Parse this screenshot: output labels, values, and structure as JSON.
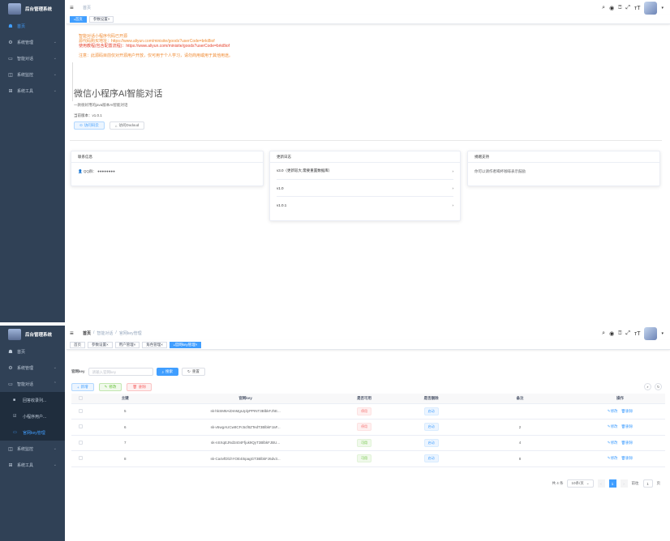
{
  "app": {
    "title": "后台管理系统"
  },
  "screen1": {
    "menu": [
      {
        "icon": "home-icon",
        "glyph": "☗",
        "label": "首页",
        "active": true
      },
      {
        "icon": "gear-icon",
        "glyph": "⚙",
        "label": "系统管理"
      },
      {
        "icon": "chat-icon",
        "glyph": "▭",
        "label": "智能对话"
      },
      {
        "icon": "monitor-icon",
        "glyph": "◫",
        "label": "系统监控"
      },
      {
        "icon": "tools-icon",
        "glyph": "⊞",
        "label": "系统工具"
      }
    ],
    "breadcrumb": [
      "首页"
    ],
    "tags": [
      {
        "label": "首页",
        "active": true
      },
      {
        "label": "参数设置"
      }
    ],
    "notice": {
      "line1": "智能对话小程序代码已开源",
      "line2": "源代码购买地址：https://www.aliyun.com/minisite/goods?userCode=brki8iof",
      "line3": "使用教程(包含配置流程)：https://www.aliyun.com/minisite/goods?userCode=brki8iof",
      "line4": "注意：此源码目前仅对开源用户开放，仅可用于个人学习，请勿商用或用于其他用途。"
    },
    "intro": {
      "title": "微信小程序AI智能对话",
      "desc": "一款很好用的java版本AI智能对话",
      "version": "当前版本：v1.0.1",
      "btn_home": "访问码云",
      "btn_dodoud": "访问Dodoud"
    },
    "cards": {
      "contact": {
        "title": "联系信息",
        "qq": "QQ群：   ●●●●●●●●"
      },
      "changelog": {
        "title": "更新日志",
        "items": [
          "v3.0（更新较大,需要重置数据库）",
          "v1.0",
          "v1.0.1"
        ]
      },
      "donate": {
        "title": "捐赠支持",
        "text": "你可以请作者喝杯咖啡表示鼓励"
      }
    }
  },
  "screen2": {
    "menu": [
      {
        "icon": "home-icon",
        "glyph": "☗",
        "label": "首页"
      },
      {
        "icon": "gear-icon",
        "glyph": "⚙",
        "label": "系统管理"
      },
      {
        "icon": "chat-icon",
        "glyph": "▭",
        "label": "智能对话",
        "open": true
      }
    ],
    "submenu": [
      {
        "icon": "list-icon",
        "glyph": "■",
        "label": "回答收录列..."
      },
      {
        "icon": "edit-icon",
        "glyph": "☑",
        "label": "小程序用户..."
      },
      {
        "icon": "key-icon",
        "glyph": "▭",
        "label": "官网key管理",
        "active": true
      }
    ],
    "menu_after": [
      {
        "icon": "monitor-icon",
        "glyph": "◫",
        "label": "系统监控"
      },
      {
        "icon": "tools-icon",
        "glyph": "⊞",
        "label": "系统工具"
      }
    ],
    "breadcrumb": [
      "首页",
      "智能对话",
      "官网key管理"
    ],
    "tags": [
      {
        "label": "首页"
      },
      {
        "label": "参数设置"
      },
      {
        "label": "用户管理"
      },
      {
        "label": "角色管理"
      },
      {
        "label": "官网key管理",
        "active": true
      }
    ],
    "search": {
      "label": "官网key",
      "placeholder": "请输入官网key",
      "search_btn": "搜索",
      "reset_btn": "重置"
    },
    "toolbar": {
      "add": "新增",
      "edit": "修改",
      "delete": "删除"
    },
    "table": {
      "headers": [
        "",
        "主键",
        "官网key",
        "是否可用",
        "是否删除",
        "备注",
        "操作"
      ],
      "rows": [
        {
          "id": "5",
          "key": "sk-hkSM8AiDmMgsJplyPPINT3BlbkFJhE...",
          "usable": "停用",
          "usable_color": "red",
          "deleted": "启动",
          "remark": ""
        },
        {
          "id": "6",
          "key": "sk-v5wgAUCw8CFc5cf8ZTedT3BlbkFJaF...",
          "usable": "停用",
          "usable_color": "red",
          "deleted": "启动",
          "remark": "2"
        },
        {
          "id": "7",
          "key": "sk-nSXqEJNd3404Ffjuk9QyT3BlbkFJBU...",
          "usable": "可用",
          "usable_color": "green",
          "deleted": "启动",
          "remark": "4"
        },
        {
          "id": "8",
          "key": "sk-Ca4vfDl1hYOE4i5pagGT3BlbkFJ6dv3...",
          "usable": "可用",
          "usable_color": "green",
          "deleted": "启动",
          "remark": "8"
        }
      ],
      "op_edit": "修改",
      "op_delete": "删除"
    },
    "pagination": {
      "total": "共 4 条",
      "page_size": "10条/页",
      "current": "1",
      "goto_label": "前往",
      "goto_value": "1",
      "page_suffix": "页"
    }
  },
  "colors": {
    "sidebar": "#304156",
    "primary": "#409eff",
    "notice_orange": "#f08a32",
    "notice_red": "#e6442e"
  }
}
